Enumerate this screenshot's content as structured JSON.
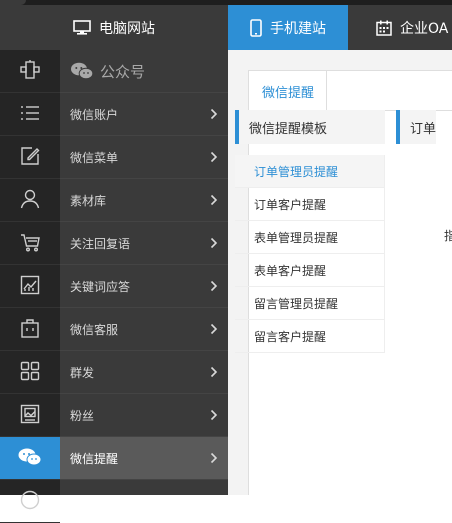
{
  "topbar": {
    "pc_label": "电脑网站",
    "mobile_label": "手机建站",
    "oa_label": "企业OA"
  },
  "sidebar": {
    "header": "公众号",
    "items": [
      {
        "label": "微信账户",
        "icon": "tag-icon"
      },
      {
        "label": "微信菜单",
        "icon": "list-icon"
      },
      {
        "label": "素材库",
        "icon": "edit-icon"
      },
      {
        "label": "关注回复语",
        "icon": "user-icon"
      },
      {
        "label": "关键词应答",
        "icon": "cart-icon"
      },
      {
        "label": "微信客服",
        "icon": "chart-icon"
      },
      {
        "label": "群发",
        "icon": "bag-icon"
      },
      {
        "label": "粉丝",
        "icon": "grid-icon"
      },
      {
        "label": "微信提醒",
        "icon": "picture-icon"
      }
    ],
    "active_index": 8
  },
  "panel": {
    "tab_label": "微信提醒",
    "left_title": "微信提醒模板",
    "right_title": "订单",
    "templates": [
      "订单管理员提醒",
      "订单客户提醒",
      "表单管理员提醒",
      "表单客户提醒",
      "留言管理员提醒",
      "留言客户提醒"
    ],
    "active_template": 0,
    "right_stub": "指"
  },
  "colors": {
    "accent": "#2d8fd5",
    "sidebar_dark": "#252525",
    "sidebar_menu": "#3a3a3a"
  }
}
